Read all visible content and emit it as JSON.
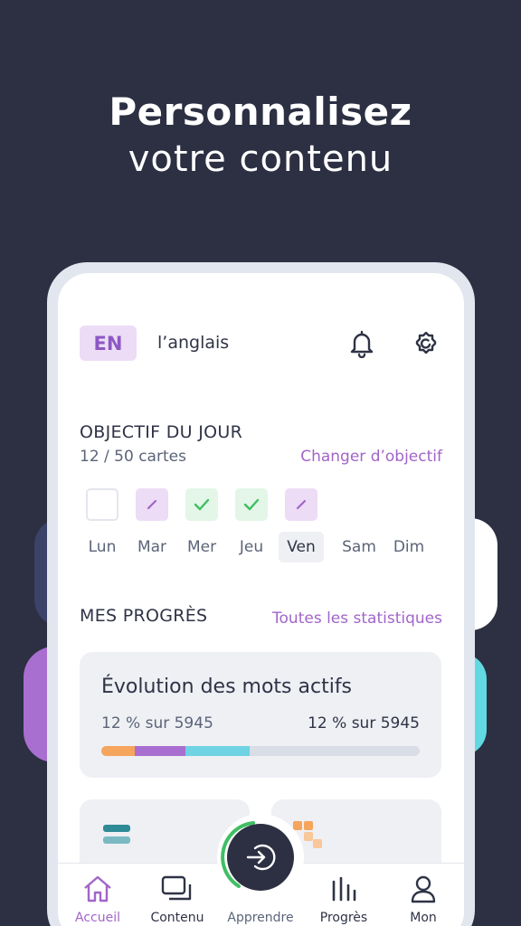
{
  "headline": {
    "line1": "Personnalisez",
    "line2": "votre contenu"
  },
  "header": {
    "lang_code": "EN",
    "lang_name": "l’anglais"
  },
  "daily_goal": {
    "title": "OBJECTIF DU JOUR",
    "progress": "12 / 50 cartes",
    "change_link": "Changer d’objectif",
    "days": [
      {
        "label": "Lun",
        "state": "empty"
      },
      {
        "label": "Mar",
        "state": "edit-icon"
      },
      {
        "label": "Mer",
        "state": "check-icon"
      },
      {
        "label": "Jeu",
        "state": "check-icon"
      },
      {
        "label": "Ven",
        "state": "edit-icon",
        "today": true
      },
      {
        "label": "Sam",
        "state": "none"
      },
      {
        "label": "Dim",
        "state": "none"
      }
    ]
  },
  "progress": {
    "title": "MES PROGRÈS",
    "all_stats_link": "Toutes les statistiques",
    "card_title": "Évolution des mots actifs",
    "left_stat": "12 % sur 5945",
    "right_stat": "12 % sur 5945",
    "bar_segments": [
      {
        "color": "#f5a55c",
        "fraction": 0.105
      },
      {
        "color": "#a96fd0",
        "fraction": 0.16
      },
      {
        "color": "#6fd3e3",
        "fraction": 0.2
      }
    ]
  },
  "tabs": [
    {
      "label": "Accueil",
      "icon": "home-icon",
      "active": true
    },
    {
      "label": "Contenu",
      "icon": "cards-icon"
    },
    {
      "label": "Apprendre",
      "icon": "enter-arrow-icon"
    },
    {
      "label": "Progrès",
      "icon": "bar-chart-icon"
    },
    {
      "label": "Mon",
      "icon": "user-icon"
    }
  ],
  "colors": {
    "accent": "#a265c9",
    "background": "#2c3042",
    "check": "#3fbf63"
  }
}
